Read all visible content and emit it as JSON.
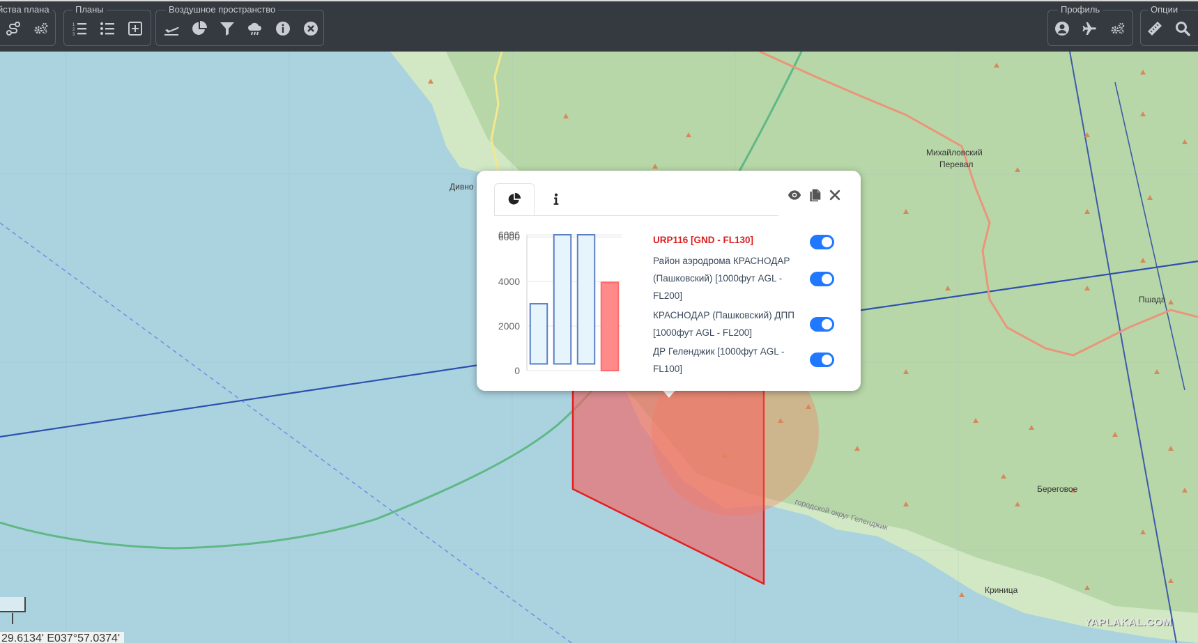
{
  "toolbar": {
    "groups": [
      {
        "label": "йства плана"
      },
      {
        "label": "Планы"
      },
      {
        "label": "Воздушное пространство"
      },
      {
        "label": "Профиль"
      },
      {
        "label": "Опции"
      }
    ]
  },
  "map": {
    "places": [
      {
        "name": "Михайловский"
      },
      {
        "name": "Перевал"
      },
      {
        "name": "Пшада"
      },
      {
        "name": "Береговое"
      },
      {
        "name": "Криница"
      },
      {
        "name": "Дивно"
      },
      {
        "name": "городской округ Геленджик"
      }
    ],
    "coordinates": "29.6134' E037°57.0374'",
    "watermark": "YAPLAKAL.COM"
  },
  "popup": {
    "tabs": [
      {
        "icon": "pie-chart-icon",
        "active": true
      },
      {
        "icon": "info-icon",
        "active": false
      }
    ],
    "controls": [
      "eye-icon",
      "copy-icon",
      "close-icon"
    ],
    "chart_data": {
      "type": "bar",
      "categories": [
        "URP116 [GND - FL130]",
        "Район аэродрома КРАСНОДАР (Пашковский) [1000фут AGL - FL200]",
        "КРАСНОДАР (Пашковский) ДПП [1000фут AGL - FL200]",
        "ДР Геленджик [1000фут AGL - FL100]"
      ],
      "y_ticks": [
        "0",
        "2000",
        "4000",
        "6000",
        "6096"
      ],
      "ylim": [
        0,
        6096
      ],
      "bars": [
        {
          "low": 300,
          "high": 3000,
          "color": "#e6f5fc",
          "border": "#5b7fc4"
        },
        {
          "low": 300,
          "high": 6096,
          "color": "#e6f5fc",
          "border": "#5b7fc4"
        },
        {
          "low": 300,
          "high": 6096,
          "color": "#e6f5fc",
          "border": "#5b7fc4"
        },
        {
          "low": 0,
          "high": 3960,
          "color": "#ff8a8a",
          "border": "#ff6b6b"
        }
      ],
      "bar_order": [
        3,
        1,
        2,
        0
      ],
      "grid": true
    },
    "airspaces": [
      {
        "line1": "URP116 [GND - FL130]",
        "highlight": true,
        "enabled": true
      },
      {
        "line1": "Район аэродрома КРАСНОДАР",
        "line2": "(Пашковский) [1000фут AGL -",
        "line3": "FL200]",
        "highlight": false,
        "enabled": true
      },
      {
        "line1": "КРАСНОДАР (Пашковский) ДПП",
        "line2": "[1000фут AGL - FL200]",
        "highlight": false,
        "enabled": true
      },
      {
        "line1": "ДР Геленджик [1000фут AGL -",
        "line2": "FL100]",
        "highlight": false,
        "enabled": true
      }
    ]
  }
}
